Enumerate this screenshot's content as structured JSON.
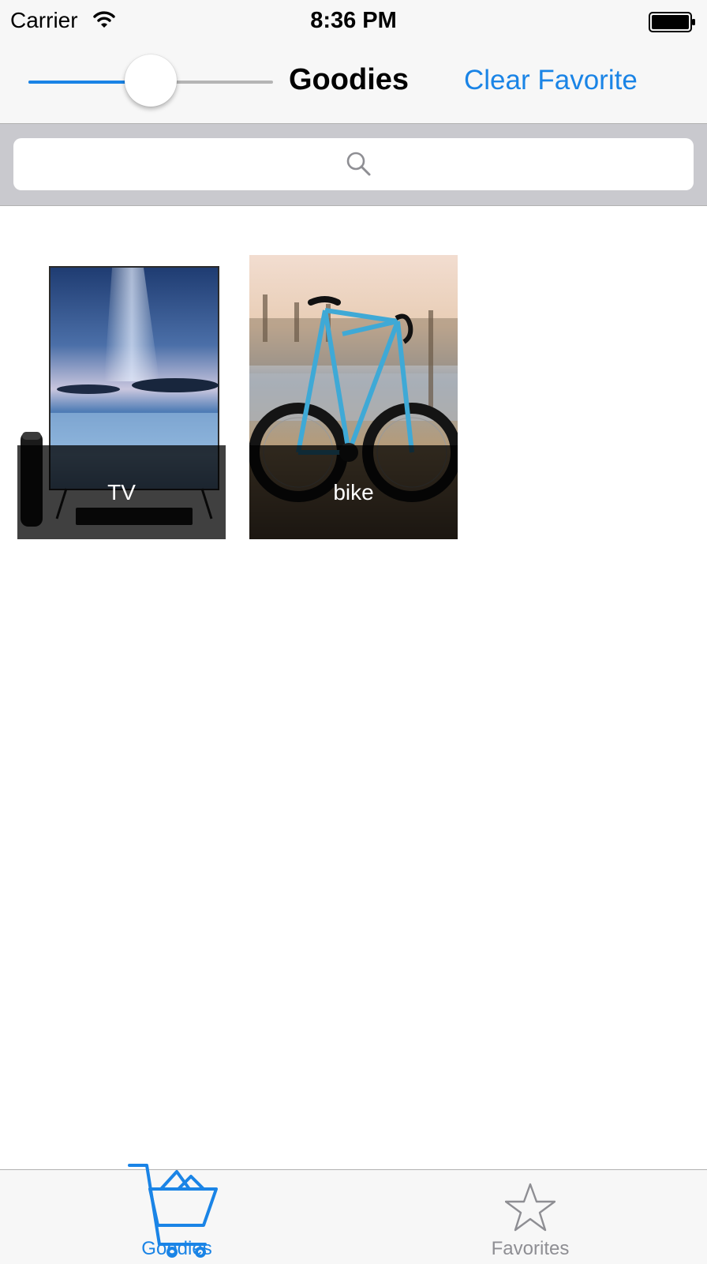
{
  "status_bar": {
    "carrier": "Carrier",
    "time": "8:36 PM",
    "wifi_icon": "wifi-icon",
    "battery_icon": "battery-icon"
  },
  "nav_bar": {
    "title": "Goodies",
    "right_button": "Clear Favorite",
    "slider": {
      "value": 0.5,
      "min_track_color": "#1a84e6",
      "max_track_color": "#b5b5b5"
    }
  },
  "search": {
    "placeholder": "",
    "icon": "magnifier-icon"
  },
  "items": [
    {
      "title": "TV",
      "image": "tv-image"
    },
    {
      "title": "bike",
      "image": "bike-image"
    }
  ],
  "tab_bar": {
    "tabs": [
      {
        "label": "Goodies",
        "icon": "shopping-cart-icon",
        "selected": true
      },
      {
        "label": "Favorites",
        "icon": "star-icon",
        "selected": false
      }
    ]
  },
  "colors": {
    "accent": "#1a84e6",
    "inactive": "#8e8e93"
  }
}
